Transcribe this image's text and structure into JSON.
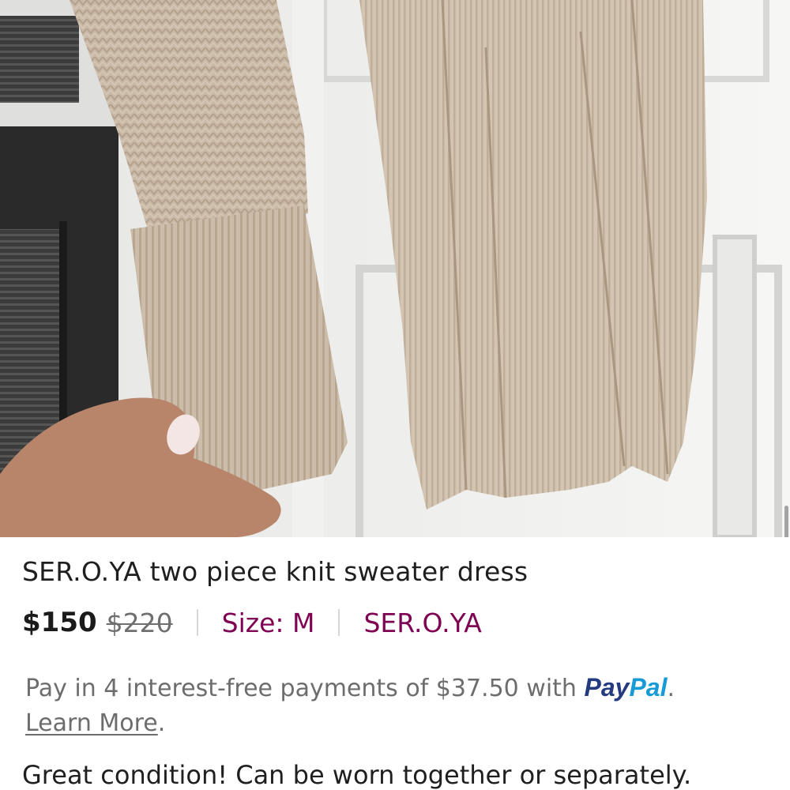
{
  "listing": {
    "title": "SER.O.YA two piece knit sweater dress",
    "price": "$150",
    "original_price": "$220",
    "size_label": "Size: M",
    "brand": "SER.O.YA",
    "paypal": {
      "text_before": "Pay in 4 interest-free payments of $37.50 with",
      "logo_part1": "Pay",
      "logo_part2": "Pal",
      "period_after_logo": ".",
      "learn_more": "Learn More",
      "period_after_link": "."
    },
    "description": "Great condition! Can be worn together or separately."
  },
  "photo": {
    "subject": "beige ribbed knit sweater dress held by hand against white door"
  },
  "colors": {
    "accent": "#7f0353",
    "paypal_dark": "#253b80",
    "paypal_light": "#179bd7",
    "text": "#1f1f1f",
    "muted": "#6d6d6d"
  }
}
